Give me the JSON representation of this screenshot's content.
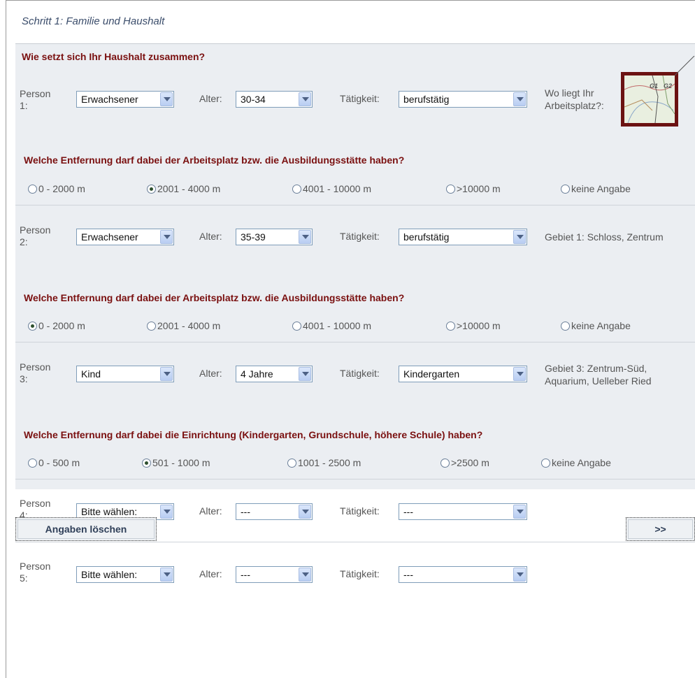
{
  "step_title": "Schritt 1: Familie und Haushalt",
  "household_question": "Wie setzt sich Ihr Haushalt zusammen?",
  "labels": {
    "alter": "Alter:",
    "taetigkeit": "Tätigkeit:"
  },
  "persons": [
    {
      "label_a": "Person",
      "label_b": "1:",
      "type": "Erwachsener",
      "age": "30-34",
      "activity": "berufstätig",
      "info_a": "Wo liegt Ihr",
      "info_b": "Arbeitsplatz?:"
    },
    {
      "label_a": "Person",
      "label_b": "2:",
      "type": "Erwachsener",
      "age": "35-39",
      "activity": "berufstätig",
      "info_a": "Gebiet 1: Schloss, Zentrum",
      "info_b": ""
    },
    {
      "label_a": "Person",
      "label_b": "3:",
      "type": "Kind",
      "age": "4 Jahre",
      "activity": "Kindergarten",
      "info_a": "Gebiet 3: Zentrum-Süd,",
      "info_b": "Aquarium, Uelleber Ried"
    },
    {
      "label_a": "Person",
      "label_b": "4:",
      "type": "Bitte wählen:",
      "age": "---",
      "activity": "---",
      "info_a": "",
      "info_b": ""
    },
    {
      "label_a": "Person",
      "label_b": "5:",
      "type": "Bitte wählen:",
      "age": "---",
      "activity": "---",
      "info_a": "",
      "info_b": ""
    }
  ],
  "distance_questions": [
    {
      "question": "Welche Entfernung darf dabei der Arbeitsplatz bzw. die Ausbildungsstätte haben?",
      "options": [
        "0 - 2000 m",
        "2001 - 4000 m",
        "4001 - 10000 m",
        ">10000 m",
        "keine Angabe"
      ],
      "selected": 1
    },
    {
      "question": "Welche Entfernung darf dabei der Arbeitsplatz bzw. die Ausbildungsstätte haben?",
      "options": [
        "0 - 2000 m",
        "2001 - 4000 m",
        "4001 - 10000 m",
        ">10000 m",
        "keine Angabe"
      ],
      "selected": 0
    },
    {
      "question": "Welche Entfernung darf dabei die Einrichtung (Kindergarten, Grundschule, höhere Schule) haben?",
      "options": [
        "0 - 500 m",
        "501 - 1000 m",
        "1001 - 2500 m",
        ">2500 m",
        "keine Angabe"
      ],
      "selected": 1
    }
  ],
  "map": {
    "g1": "G1",
    "g2": "G2"
  },
  "buttons": {
    "clear": "Angaben löschen",
    "next": ">>"
  },
  "colors": {
    "heading": "#7a1010",
    "panel": "#ebeef2",
    "map_border": "#6b1212"
  }
}
